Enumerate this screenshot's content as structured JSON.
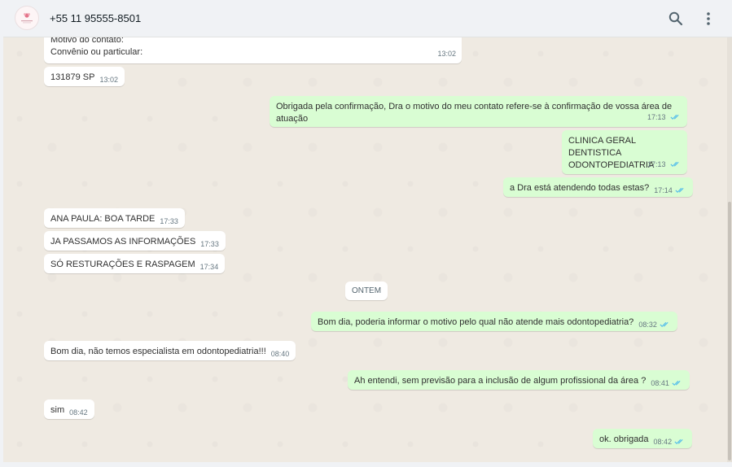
{
  "header": {
    "contact_name": "+55 11 95555-8501",
    "search_icon": "search-icon",
    "menu_icon": "kebab-menu-icon"
  },
  "colors": {
    "chat_background": "#efeae2",
    "incoming_bubble": "#ffffff",
    "outgoing_bubble": "#d9fdd3",
    "read_ticks": "#53bdeb",
    "header_background": "#f0f2f5"
  },
  "date_divider": "ONTEM",
  "messages": [
    {
      "direction": "in",
      "lines": [
        "Motivo do contato:",
        "Convênio ou particular:"
      ],
      "time": "13:02"
    },
    {
      "direction": "in",
      "text": "131879 SP",
      "time": "13:02"
    },
    {
      "direction": "out",
      "text": "Obrigada pela confirmação, Dra o motivo do meu contato refere-se à confirmação de vossa área de atuação",
      "time": "17:13"
    },
    {
      "direction": "out",
      "lines": [
        "CLINICA GERAL",
        "DENTISTICA",
        "ODONTOPEDIATRIA"
      ],
      "time": "17:13"
    },
    {
      "direction": "out",
      "text": "a Dra está atendendo todas estas?",
      "time": "17:14"
    },
    {
      "direction": "in",
      "text": "ANA PAULA: BOA TARDE",
      "time": "17:33"
    },
    {
      "direction": "in",
      "text": "JA PASSAMOS AS INFORMAÇÕES",
      "time": "17:33"
    },
    {
      "direction": "in",
      "text": "SÓ RESTURAÇÕES E RASPAGEM",
      "time": "17:34"
    },
    {
      "direction": "out",
      "text": "Bom dia, poderia informar o motivo pelo qual não atende mais odontopediatria?",
      "time": "08:32"
    },
    {
      "direction": "in",
      "text": "Bom dia, não temos especialista em odontopediatria!!!",
      "time": "08:40"
    },
    {
      "direction": "out",
      "text": "Ah entendi, sem previsão para a inclusão de algum profissional da área ?",
      "time": "08:41"
    },
    {
      "direction": "in",
      "text": "sim",
      "time": "08:42"
    },
    {
      "direction": "out",
      "text": "ok. obrigada",
      "time": "08:42"
    }
  ]
}
